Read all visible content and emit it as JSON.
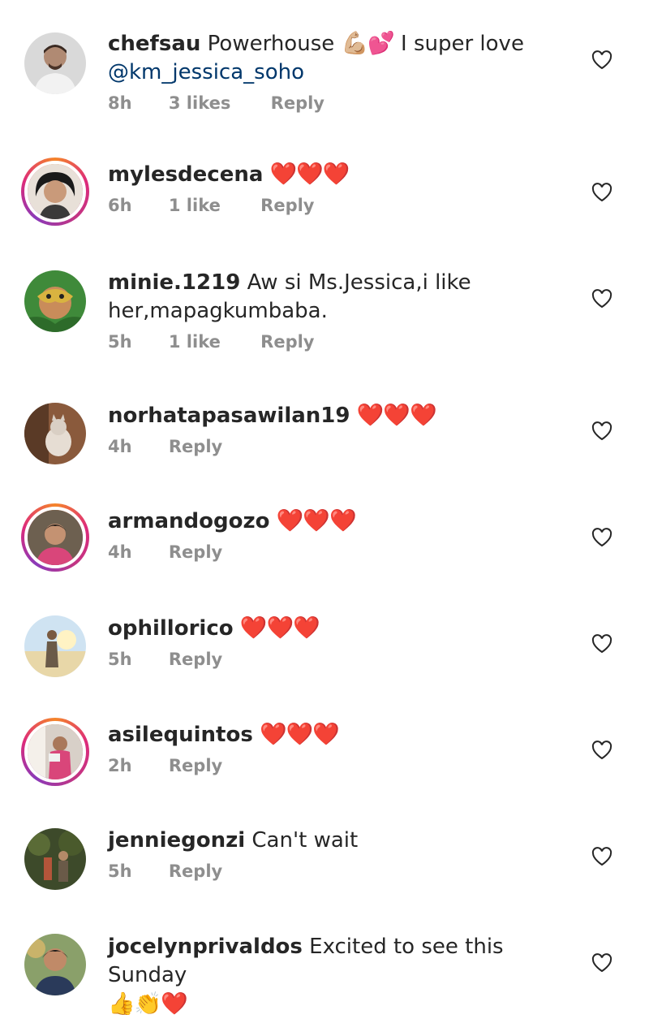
{
  "comments": [
    {
      "username": "chefsau",
      "text": "Powerhouse",
      "emoji": "💪🏼💕",
      "text2": "I super love",
      "mention": "@km_jessica_soho",
      "time": "8h",
      "likes": "3 likes",
      "reply": "Reply"
    },
    {
      "username": "mylesdecena",
      "emoji": "❤️❤️❤️",
      "time": "6h",
      "likes": "1 like",
      "reply": "Reply"
    },
    {
      "username": "minie.1219",
      "text": "Aw si Ms.Jessica,i like",
      "text_line2": "her,mapagkumbaba.",
      "time": "5h",
      "likes": "1 like",
      "reply": "Reply"
    },
    {
      "username": "norhatapasawilan19",
      "emoji": "❤️❤️❤️",
      "time": "4h",
      "reply": "Reply"
    },
    {
      "username": "armandogozo",
      "emoji": "❤️❤️❤️",
      "time": "4h",
      "reply": "Reply"
    },
    {
      "username": "ophillorico",
      "emoji": "❤️❤️❤️",
      "time": "5h",
      "reply": "Reply"
    },
    {
      "username": "asilequintos",
      "emoji": "❤️❤️❤️",
      "time": "2h",
      "reply": "Reply"
    },
    {
      "username": "jenniegonzi",
      "text": "Can't wait",
      "time": "5h",
      "reply": "Reply"
    },
    {
      "username": "jocelynprivaldos",
      "text": "Excited to see this Sunday",
      "emoji_line2": "👍👏❤️"
    }
  ],
  "icons": {
    "like": "heart-outline-icon"
  },
  "colors": {
    "text": "#262626",
    "meta": "#8e8e8e",
    "mention": "#00376b",
    "story_ring": "#dd2a7b"
  }
}
